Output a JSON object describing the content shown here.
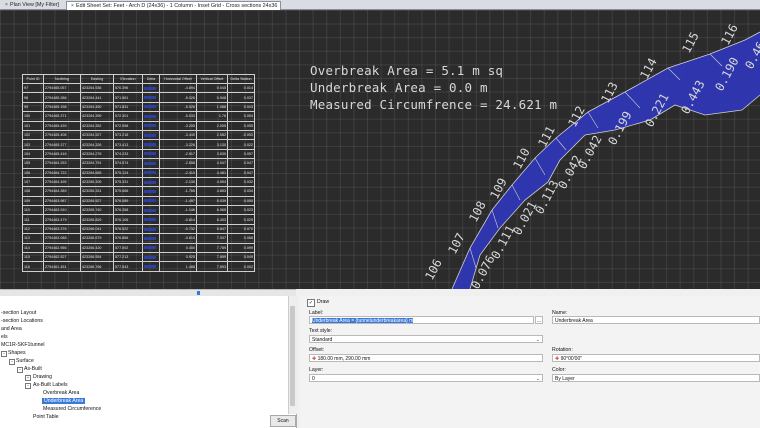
{
  "tabs": [
    {
      "label": "Plan View [My Filter]",
      "active": false
    },
    {
      "label": "Edit Sheet Set: Feet - Arch D (24x36) - 1 Column - Inset Grid - Cross sections 24x36",
      "active": true
    }
  ],
  "table": {
    "headers": [
      "Point ID",
      "Northing",
      "Easting",
      "Elevation",
      "Delta",
      "Horizontal Offset",
      "Vertical Offset",
      "Delta Station"
    ],
    "rows": [
      [
        "97",
        "2794465.057",
        "423264.536",
        "570.396",
        "",
        "-4.894",
        "0.045",
        "0.014"
      ],
      [
        "98",
        "2794465.286",
        "423264.441",
        "571.561",
        "",
        "-5.026",
        "0.948",
        "0.037"
      ],
      [
        "99",
        "2794465.196",
        "423264.450",
        "571.831",
        "",
        "-5.026",
        "1.088",
        "0.043"
      ],
      [
        "100",
        "2794465.371",
        "423264.399",
        "572.301",
        "",
        "-5.033",
        "1.76",
        "0.054"
      ],
      [
        "101",
        "2794465.439",
        "423264.352",
        "572.958",
        "",
        "-3.205",
        "2.005",
        "0.055"
      ],
      [
        "102",
        "2794465.406",
        "423264.527",
        "573.218",
        "",
        "-3.440",
        "2.582",
        "-0.053"
      ],
      [
        "103",
        "2794465.377",
        "423264.326",
        "573.413",
        "",
        "-3.226",
        "3.130",
        "0.022"
      ],
      [
        "104",
        "2794465.416",
        "423264.276",
        "574.233",
        "",
        "-2.917",
        "3.630",
        "0.057"
      ],
      [
        "105",
        "2794464.253",
        "423264.751",
        "574.574",
        "",
        "-2.658",
        "4.047",
        "0.047"
      ],
      [
        "106",
        "2794464.722",
        "423264.665",
        "575.124",
        "",
        "-2.410",
        "4.481",
        "0.047"
      ],
      [
        "107",
        "2794464.495",
        "423265.305",
        "575.331",
        "",
        "-2.130",
        "4.594",
        "0.032"
      ],
      [
        "108",
        "2794464.389",
        "423265.331",
        "575.666",
        "",
        "-1.765",
        "4.853",
        "0.034"
      ],
      [
        "109",
        "2794463.987",
        "423265.527",
        "576.089",
        "",
        "-1.497",
        "5.039",
        "0.000"
      ],
      [
        "110",
        "2794463.910",
        "423265.740",
        "576.358",
        "",
        "-1.146",
        "6.065",
        "0.023"
      ],
      [
        "111",
        "2794463.479",
        "423265.829",
        "576.106",
        "",
        "-0.814",
        "6.303",
        "0.029"
      ],
      [
        "112",
        "2794463.376",
        "423266.041",
        "576.522",
        "",
        "-0.732",
        "6.847",
        "0.070"
      ],
      [
        "113",
        "2794463.088",
        "423266.679",
        "576.866",
        "",
        "-0.615",
        "7.037",
        "0.068"
      ],
      [
        "114",
        "2794462.956",
        "423266.420",
        "577.002",
        "",
        "0.450",
        "7.789",
        "0.099"
      ],
      [
        "115",
        "2794462.527",
        "423266.554",
        "577.213",
        "",
        "0.925",
        "7.899",
        "0.049"
      ],
      [
        "116",
        "2794461.451",
        "423266.766",
        "577.543",
        "",
        "1.488",
        "7.893",
        "0.002"
      ]
    ]
  },
  "annotations": {
    "overbreak": "Overbreak Area = 5.1 m sq",
    "underbreak": "Underbreak Area = 0.0 m",
    "circumference": "Measured Circumfrence = 24.621 m"
  },
  "profile_labels": {
    "point_ids": [
      "106",
      "107",
      "108",
      "109",
      "110",
      "111",
      "112",
      "113",
      "114",
      "115",
      "116"
    ],
    "offsets": [
      "0.076",
      "0.111",
      "0.021",
      "0.113",
      "0.042",
      "0.042",
      "0.199",
      "0.221",
      "0.443",
      "0.190",
      "0.46"
    ]
  },
  "tree": {
    "items": [
      "-section Layout",
      "-section Locations",
      "and Area",
      "els",
      "MC1R-SKF1tunnel",
      "Shapes",
      "Surface",
      "As-Built",
      "Drawing",
      "As-Built Labels",
      "Overbreak Area",
      "Underbreak Area",
      "Measured Circumference",
      "Point Table"
    ],
    "selected": "Underbreak Area",
    "scan_label": "Scan"
  },
  "props": {
    "draw_label": "Draw",
    "draw_checked": true,
    "label_caption": "Label:",
    "label_value": "Underbreak Area = {tunnelunderbreakarea} m",
    "name_caption": "Name:",
    "name_value": "Underbreak Area",
    "text_style_caption": "Text style:",
    "text_style_value": "Standard",
    "offset_caption": "Offset:",
    "offset_value": "180.00 mm, 290.00 mm",
    "rotation_caption": "Rotation:",
    "rotation_value": "90°00'00\"",
    "layer_caption": "Layer:",
    "layer_value": "0",
    "color_caption": "Color:",
    "color_value": "By Layer"
  },
  "colors": {
    "canvas_bg": "#2b2b2b",
    "fill_blue": "#2f36b8",
    "selection": "#3b78d8"
  }
}
